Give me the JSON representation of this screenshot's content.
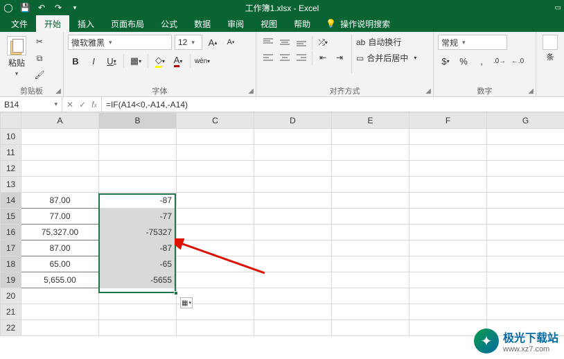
{
  "title": "工作簿1.xlsx - Excel",
  "tabs": {
    "file": "文件",
    "home": "开始",
    "insert": "插入",
    "layout": "页面布局",
    "formulas": "公式",
    "data": "数据",
    "review": "审阅",
    "view": "视图",
    "help": "帮助",
    "tell": "操作说明搜索"
  },
  "ribbon": {
    "clipboard": {
      "paste": "粘贴",
      "label": "剪贴板"
    },
    "font": {
      "name": "微软雅黑",
      "size": "12",
      "label": "字体"
    },
    "alignment": {
      "wrap": "自动换行",
      "merge": "合并后居中",
      "label": "对齐方式"
    },
    "number": {
      "format": "常规",
      "label": "数字"
    },
    "styles": {
      "cond": "条"
    }
  },
  "namebox": "B14",
  "formula": "=IF(A14<0,-A14,-A14)",
  "columns": [
    "A",
    "B",
    "C",
    "D",
    "E",
    "F",
    "G"
  ],
  "row_start": 10,
  "rows": [
    {
      "r": 10,
      "a": "",
      "b": ""
    },
    {
      "r": 11,
      "a": "",
      "b": ""
    },
    {
      "r": 12,
      "a": "",
      "b": ""
    },
    {
      "r": 13,
      "a": "",
      "b": ""
    },
    {
      "r": 14,
      "a": "87.00",
      "b": "-87"
    },
    {
      "r": 15,
      "a": "77.00",
      "b": "-77"
    },
    {
      "r": 16,
      "a": "75,327.00",
      "b": "-75327"
    },
    {
      "r": 17,
      "a": "87.00",
      "b": "-87"
    },
    {
      "r": 18,
      "a": "65.00",
      "b": "-65"
    },
    {
      "r": 19,
      "a": "5,655.00",
      "b": "-5655"
    },
    {
      "r": 20,
      "a": "",
      "b": ""
    },
    {
      "r": 21,
      "a": "",
      "b": ""
    },
    {
      "r": 22,
      "a": "",
      "b": ""
    }
  ],
  "data_rows": {
    "first": 14,
    "last": 19
  },
  "selection": {
    "col": "B",
    "row_first": 14,
    "row_last": 19
  },
  "watermark": {
    "name": "极光下载站",
    "url": "www.xz7.com"
  }
}
